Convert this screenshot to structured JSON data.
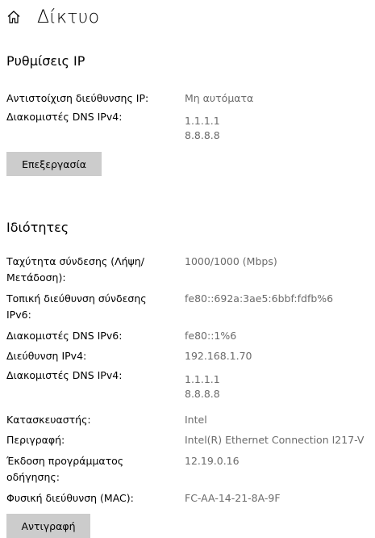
{
  "header": {
    "title": "Δίκτυο",
    "icon": "home-icon"
  },
  "ip_settings": {
    "title": "Ρυθμίσεις IP",
    "rows": [
      {
        "label": "Αντιστοίχιση διεύθυνσης IP:",
        "value": "Μη αυτόματα"
      },
      {
        "label": "Διακομιστές DNS IPv4:",
        "value1": "1.1.1.1",
        "value2": "8.8.8.8"
      }
    ],
    "edit_label": "Επεξεργασία"
  },
  "properties": {
    "title": "Ιδιότητες",
    "rows": [
      {
        "label1": "Ταχύτητα σύνδεσης (Λήψη/",
        "label2": "Μετάδοση):",
        "value": "1000/1000 (Mbps)"
      },
      {
        "label1": "Τοπική διεύθυνση σύνδεσης",
        "label2": "IPv6:",
        "value": "fe80::692a:3ae5:6bbf:fdfb%6"
      },
      {
        "label": "Διακομιστές DNS IPv6:",
        "value": "fe80::1%6"
      },
      {
        "label": "Διεύθυνση IPv4:",
        "value": "192.168.1.70"
      },
      {
        "label": "Διακομιστές DNS IPv4:",
        "value1": "1.1.1.1",
        "value2": "8.8.8.8"
      },
      {
        "label": "Κατασκευαστής:",
        "value": "Intel"
      },
      {
        "label": "Περιγραφή:",
        "value": "Intel(R) Ethernet Connection I217-V"
      },
      {
        "label1": "Έκδοση προγράμματος",
        "label2": "οδήγησης:",
        "value": "12.19.0.16"
      },
      {
        "label": "Φυσική διεύθυνση (MAC):",
        "value": "FC-AA-14-21-8A-9F"
      }
    ],
    "copy_label": "Αντιγραφή"
  }
}
